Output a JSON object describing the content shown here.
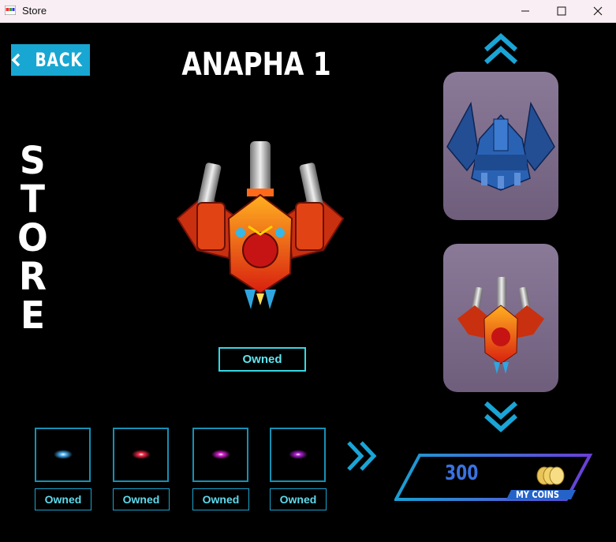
{
  "window": {
    "title": "Store"
  },
  "store": {
    "back_label": "BACK",
    "ship_name": "ANAPHA 1",
    "side_title": [
      "S",
      "T",
      "O",
      "R",
      "E"
    ],
    "main_status": "Owned",
    "bullets": [
      {
        "color": "#4fb8ff",
        "status": "Owned"
      },
      {
        "color": "#ff2a4a",
        "status": "Owned"
      },
      {
        "color": "#e021d8",
        "status": "Owned"
      },
      {
        "color": "#b21fd8",
        "status": "Owned"
      }
    ],
    "coins": {
      "value": "300",
      "label": "MY COINS"
    }
  },
  "colors": {
    "accent": "#17a7d2",
    "panel": "#7c6a8a",
    "owned_border": "#38d6e3"
  },
  "icons": [
    "back-chevron-icon",
    "chevron-up-icon",
    "chevron-down-icon",
    "double-chevron-right-icon",
    "coins-icon"
  ]
}
